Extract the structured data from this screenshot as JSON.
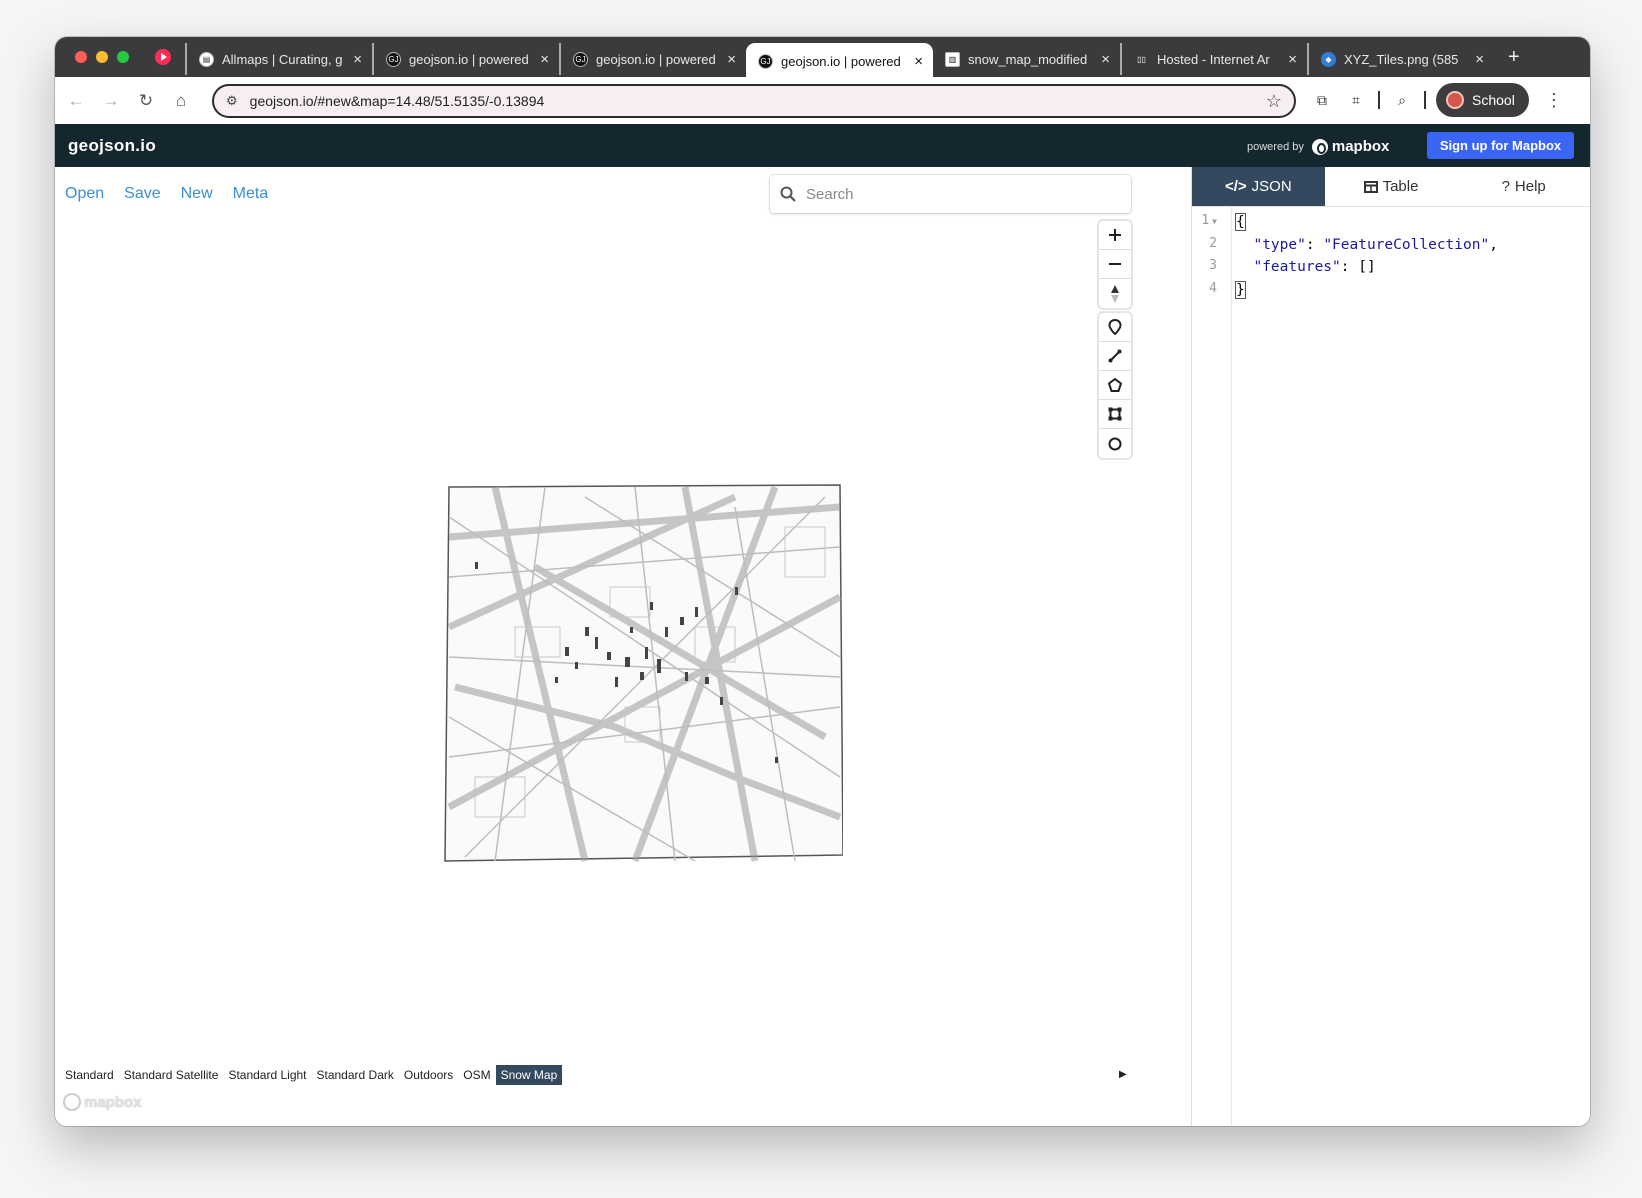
{
  "browser": {
    "tabs": [
      {
        "title": "Allmaps | Curating, g",
        "icon": "allmaps-icon"
      },
      {
        "title": "geojson.io | powered",
        "icon": "geojson-icon"
      },
      {
        "title": "geojson.io | powered",
        "icon": "geojson-icon"
      },
      {
        "title": "geojson.io | powered",
        "icon": "geojson-icon",
        "active": true
      },
      {
        "title": "snow_map_modified",
        "icon": "archive-icon"
      },
      {
        "title": "Hosted - Internet Ar",
        "icon": "internet-archive-icon"
      },
      {
        "title": "XYZ_Tiles.png (585",
        "icon": "image-icon"
      }
    ],
    "url": "geojson.io/#new&map=14.48/51.5135/-0.13894",
    "profile_label": "School"
  },
  "app": {
    "brand": "geojson.io",
    "powered_by": "powered by",
    "mapbox_label": "mapbox",
    "signup_label": "Sign up for Mapbox"
  },
  "menu": {
    "open": "Open",
    "save": "Save",
    "new": "New",
    "meta": "Meta"
  },
  "search": {
    "placeholder": "Search"
  },
  "basemaps": {
    "items": [
      "Standard",
      "Standard Satellite",
      "Standard Light",
      "Standard Dark",
      "Outdoors",
      "OSM",
      "Snow Map"
    ],
    "selected": "Snow Map"
  },
  "watermark": "mapbox",
  "panel": {
    "tabs": {
      "json": "JSON",
      "table": "Table",
      "help": "Help"
    },
    "line_numbers": [
      "1",
      "2",
      "3",
      "4"
    ],
    "code": {
      "open_brace": "{",
      "type_key": "\"type\"",
      "type_value": "\"FeatureCollection\"",
      "features_key": "\"features\"",
      "features_value": "[]",
      "close_brace": "}"
    }
  },
  "colors": {
    "header_bg": "#14262e",
    "link": "#3a8fd1",
    "signup": "#3b66f5",
    "active_tab": "#34495e"
  }
}
